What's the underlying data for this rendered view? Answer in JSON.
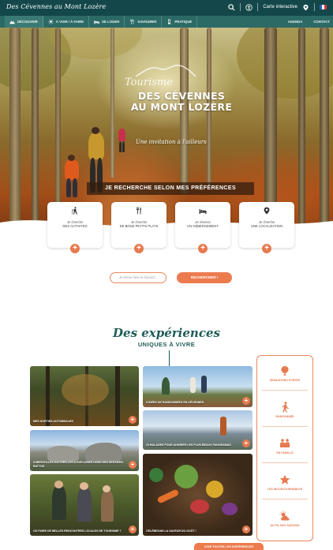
{
  "topbar": {
    "brand": "Des Cévennes au Mont Lozère",
    "carte_label": "Carte interactive",
    "colors": {
      "bg": "#14474a",
      "nav": "#2c6a66",
      "accent": "#e77a50"
    }
  },
  "nav": {
    "items": [
      {
        "label": "DÉCOUVRIR",
        "icon": "mountain-icon"
      },
      {
        "label": "À VOIR / À FAIRE",
        "icon": "sun-icon"
      },
      {
        "label": "SE LOGER",
        "icon": "bed-icon"
      },
      {
        "label": "SAVOURER",
        "icon": "fork-knife-icon"
      },
      {
        "label": "PRATIQUE",
        "icon": "info-icon"
      }
    ],
    "right": [
      "AGENDA",
      "CONTACT"
    ]
  },
  "hero": {
    "script": "Tourisme",
    "title_line1": "DES CÉVENNES",
    "title_line2": "AU MONT LOZÈRE",
    "subtitle": "Une invitation à l'ailleurs",
    "search_heading": "JE RECHERCHE SELON MES PRÉFÉRENCES"
  },
  "cards": [
    {
      "pre": "Je cherche",
      "text": "DES ACTIVITÉS",
      "icon": "hiker-icon"
    },
    {
      "pre": "Je cherche",
      "text": "DE BONS PETITS PLATS",
      "icon": "fork-knife-icon"
    },
    {
      "pre": "Je réserve",
      "text": "UN HÉBERGEMENT",
      "icon": "bed-icon"
    },
    {
      "pre": "Je cherche",
      "text": "UNE LOCALISATION",
      "icon": "map-pin-icon"
    }
  ],
  "buttons": {
    "random": "Je laisse faire le hasard...",
    "search": "RECHERCHER !"
  },
  "experiences": {
    "script": "Des expériences",
    "subtitle": "UNIQUES À VIVRE",
    "tiles": [
      {
        "label": "MES SORTIES AUTOMNALES"
      },
      {
        "label": "5 IDÉES DE RANDONNÉES EN CÉVENNES"
      },
      {
        "label": "10 BALADES POUR ADMIRER LES PLUS BEAUX PANORAMAS"
      },
      {
        "label": "3 MERVEILLES NATURELLES À EXPLORER HORS DES SENTIERS BATTUS"
      },
      {
        "label": "CÉLÉBRONS LA SAVEUR DU GOÛT !"
      },
      {
        "label": "OÙ FAIRE DE BELLES RENCONTRES LOCALES DE TOURISME ?"
      }
    ],
    "side": [
      {
        "label": "SENSATIONS FORTES",
        "icon": "balloon-icon"
      },
      {
        "label": "RANDONNÉE",
        "icon": "runner-icon"
      },
      {
        "label": "EN FAMILLE",
        "icon": "family-icon"
      },
      {
        "label": "LES INCONTOURNABLES",
        "icon": "star-icon"
      },
      {
        "label": "AU FIL DES SAISONS",
        "icon": "weather-icon"
      }
    ],
    "cta": "VOIR TOUTES LES EXPÉRIENCES"
  }
}
